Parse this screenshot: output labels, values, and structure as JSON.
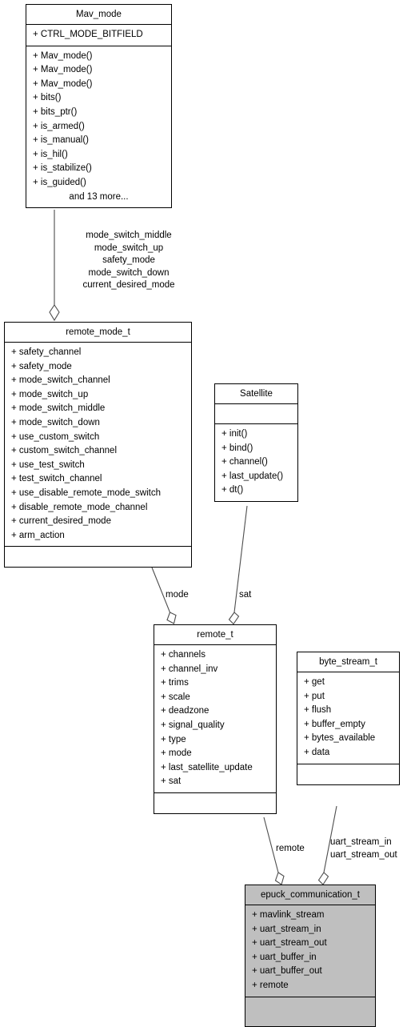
{
  "diagram": {
    "type": "uml-class-diagram",
    "background_color": "#ffffff",
    "line_color": "#4d4d4d",
    "highlight_color": "#bfbfbf"
  },
  "classes": {
    "mav_mode": {
      "name": "Mav_mode",
      "attributes": [
        "+ CTRL_MODE_BITFIELD"
      ],
      "methods": [
        "+ Mav_mode()",
        "+ Mav_mode()",
        "+ Mav_mode()",
        "+ bits()",
        "+ bits_ptr()",
        "+ is_armed()",
        "+ is_manual()",
        "+ is_hil()",
        "+ is_stabilize()",
        "+ is_guided()"
      ],
      "more": "and 13 more..."
    },
    "remote_mode_t": {
      "name": "remote_mode_t",
      "attributes": [
        "+ safety_channel",
        "+ safety_mode",
        "+ mode_switch_channel",
        "+ mode_switch_up",
        "+ mode_switch_middle",
        "+ mode_switch_down",
        "+ use_custom_switch",
        "+ custom_switch_channel",
        "+ use_test_switch",
        "+ test_switch_channel",
        "+ use_disable_remote_mode_switch",
        "+ disable_remote_mode_channel",
        "+ current_desired_mode",
        "+ arm_action"
      ],
      "methods": []
    },
    "satellite": {
      "name": "Satellite",
      "attributes": [],
      "methods": [
        "+ init()",
        "+ bind()",
        "+ channel()",
        "+ last_update()",
        "+ dt()"
      ]
    },
    "remote_t": {
      "name": "remote_t",
      "attributes": [
        "+ channels",
        "+ channel_inv",
        "+ trims",
        "+ scale",
        "+ deadzone",
        "+ signal_quality",
        "+ type",
        "+ mode",
        "+ last_satellite_update",
        "+ sat"
      ],
      "methods": []
    },
    "byte_stream_t": {
      "name": "byte_stream_t",
      "attributes": [
        "+ get",
        "+ put",
        "+ flush",
        "+ buffer_empty",
        "+ bytes_available",
        "+ data"
      ],
      "methods": []
    },
    "epuck_communication_t": {
      "name": "epuck_communication_t",
      "attributes": [
        "+ mavlink_stream",
        "+ uart_stream_in",
        "+ uart_stream_out",
        "+ uart_buffer_in",
        "+ uart_buffer_out",
        "+ remote"
      ],
      "methods": [],
      "highlighted": true
    }
  },
  "edges": {
    "mav_mode_to_remote_mode_t": {
      "label": "mode_switch_middle\nmode_switch_up\nsafety_mode\nmode_switch_down\ncurrent_desired_mode",
      "line1": "mode_switch_middle",
      "line2": "mode_switch_up",
      "line3": "safety_mode",
      "line4": "mode_switch_down",
      "line5": "current_desired_mode"
    },
    "remote_mode_t_to_remote_t": {
      "label": "mode"
    },
    "satellite_to_remote_t": {
      "label": "sat"
    },
    "remote_t_to_epuck": {
      "label": "remote"
    },
    "byte_stream_to_epuck": {
      "line1": "uart_stream_in",
      "line2": "uart_stream_out"
    }
  }
}
